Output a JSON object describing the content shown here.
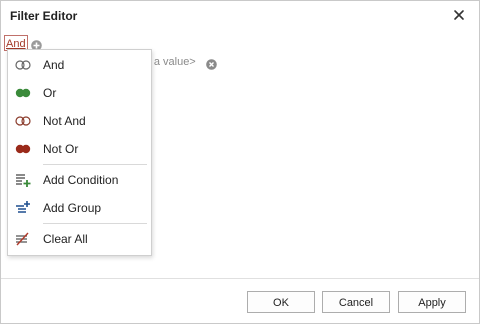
{
  "dialog": {
    "title": "Filter Editor"
  },
  "filter": {
    "group_operator": "And",
    "value_placeholder": "er a value>"
  },
  "menu": {
    "items": [
      {
        "label": "And",
        "icon": "and-group-icon"
      },
      {
        "label": "Or",
        "icon": "or-group-icon"
      },
      {
        "label": "Not And",
        "icon": "not-and-group-icon"
      },
      {
        "label": "Not Or",
        "icon": "not-or-group-icon"
      },
      {
        "label": "Add Condition",
        "icon": "add-condition-icon"
      },
      {
        "label": "Add Group",
        "icon": "add-group-icon"
      },
      {
        "label": "Clear All",
        "icon": "clear-all-icon"
      }
    ]
  },
  "footer": {
    "ok_label": "OK",
    "cancel_label": "Cancel",
    "apply_label": "Apply"
  },
  "colors": {
    "operator_red": "#a33a2a",
    "or_green": "#3a8a3a",
    "not_or_red": "#9a2a1a",
    "icon_blue": "#1f4f8f"
  }
}
